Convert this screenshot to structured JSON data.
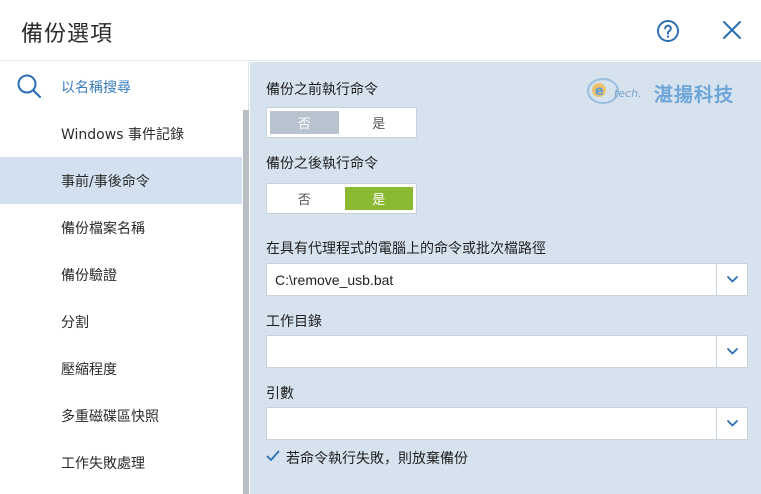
{
  "header": {
    "title": "備份選項"
  },
  "sidebar": {
    "search_label": "以名稱搜尋",
    "items": [
      {
        "label": "Windows 事件記錄"
      },
      {
        "label": "事前/事後命令"
      },
      {
        "label": "備份檔案名稱"
      },
      {
        "label": "備份驗證"
      },
      {
        "label": "分割"
      },
      {
        "label": "壓縮程度"
      },
      {
        "label": "多重磁碟區快照"
      },
      {
        "label": "工作失敗處理"
      }
    ],
    "active_index": 1
  },
  "main": {
    "pre_command": {
      "label": "備份之前執行命令",
      "no": "否",
      "yes": "是",
      "selected": "no"
    },
    "post_command": {
      "label": "備份之後執行命令",
      "no": "否",
      "yes": "是",
      "selected": "yes"
    },
    "command_path": {
      "label": "在具有代理程式的電腦上的命令或批次檔路徑",
      "value": "C:\\remove_usb.bat"
    },
    "working_dir": {
      "label": "工作目錄",
      "value": ""
    },
    "arguments": {
      "label": "引數",
      "value": ""
    },
    "abort_on_fail": {
      "label": "若命令執行失敗，則放棄備份",
      "checked": true
    },
    "watermark": {
      "tech": "tech.",
      "text": "湛揚科技"
    }
  },
  "colors": {
    "accent": "#3b7dbf",
    "toggle_yes": "#8bb932",
    "toggle_no": "#b8c3cf",
    "panel_bg": "#d7e2ef",
    "active_item": "#d3e0ef"
  }
}
